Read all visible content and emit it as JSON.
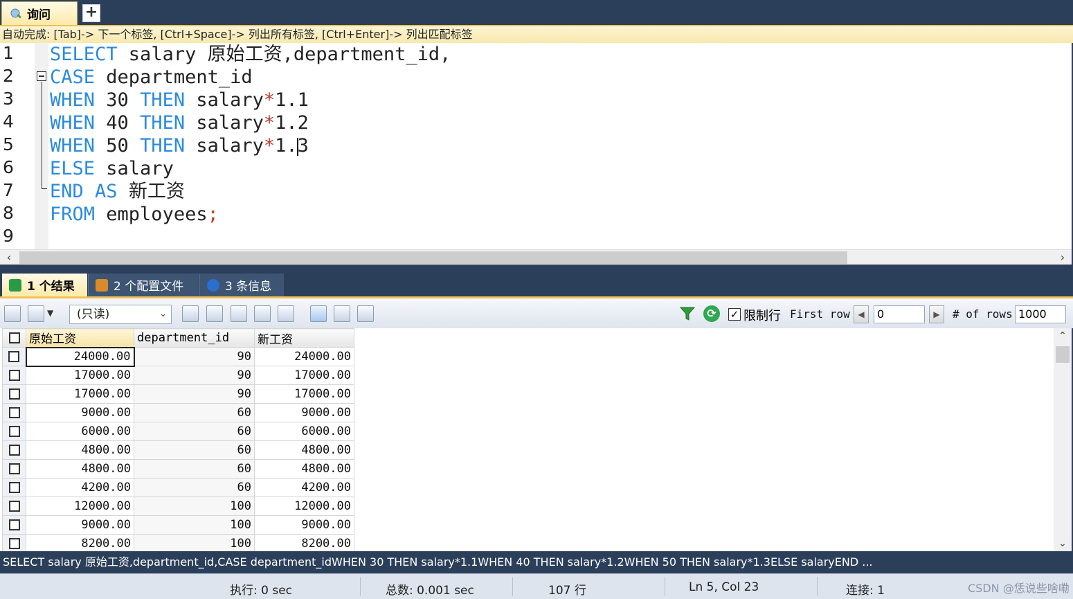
{
  "query_tab": {
    "label": "询问",
    "add_label": "+"
  },
  "autocomplete_hint": "自动完成: [Tab]-> 下一个标签, [Ctrl+Space]-> 列出所有标签, [Ctrl+Enter]-> 列出匹配标签",
  "editor": {
    "line_numbers": [
      "1",
      "2",
      "3",
      "4",
      "5",
      "6",
      "7",
      "8",
      "9"
    ],
    "lines": [
      [
        {
          "t": "SELECT",
          "c": "kw"
        },
        {
          "t": " salary 原始工资,department_id,"
        }
      ],
      [
        {
          "t": "CASE",
          "c": "kw"
        },
        {
          "t": " department_id"
        }
      ],
      [
        {
          "t": "WHEN",
          "c": "kw"
        },
        {
          "t": " 30 "
        },
        {
          "t": "THEN",
          "c": "kw"
        },
        {
          "t": " salary"
        },
        {
          "t": "*",
          "c": "op"
        },
        {
          "t": "1.1"
        }
      ],
      [
        {
          "t": "WHEN",
          "c": "kw"
        },
        {
          "t": " 40 "
        },
        {
          "t": "THEN",
          "c": "kw"
        },
        {
          "t": " salary"
        },
        {
          "t": "*",
          "c": "op"
        },
        {
          "t": "1.2"
        }
      ],
      [
        {
          "t": "WHEN",
          "c": "kw"
        },
        {
          "t": " 50 "
        },
        {
          "t": "THEN",
          "c": "kw"
        },
        {
          "t": " salary"
        },
        {
          "t": "*",
          "c": "op"
        },
        {
          "t": "1."
        },
        {
          "caret": true
        },
        {
          "t": "3"
        }
      ],
      [
        {
          "t": "ELSE",
          "c": "kw"
        },
        {
          "t": " salary"
        }
      ],
      [
        {
          "t": "END",
          "c": "kw"
        },
        {
          "t": " "
        },
        {
          "t": "AS",
          "c": "kw"
        },
        {
          "t": " 新工资"
        }
      ],
      [
        {
          "t": "FROM",
          "c": "kw"
        },
        {
          "t": " employees"
        },
        {
          "t": ";",
          "c": "op"
        }
      ],
      []
    ]
  },
  "result_tabs": [
    {
      "label": "1 个结果",
      "icon": "grid-result-icon",
      "color": "#2a9a44"
    },
    {
      "label": "2 个配置文件",
      "icon": "profile-icon",
      "color": "#d98a2b"
    },
    {
      "label": "3 条信息",
      "icon": "info-icon",
      "color": "#2a6fd0"
    }
  ],
  "toolbar": {
    "mode_select": "(只读)",
    "limit_checked": true,
    "limit_label": "限制行",
    "first_row_label": "First row",
    "first_row_value": "0",
    "rows_label": "# of rows",
    "rows_value": "1000"
  },
  "grid": {
    "columns": [
      "原始工资",
      "department_id",
      "新工资"
    ],
    "rows": [
      [
        "24000.00",
        "90",
        "24000.00"
      ],
      [
        "17000.00",
        "90",
        "17000.00"
      ],
      [
        "17000.00",
        "90",
        "17000.00"
      ],
      [
        "9000.00",
        "60",
        "9000.00"
      ],
      [
        "6000.00",
        "60",
        "6000.00"
      ],
      [
        "4800.00",
        "60",
        "4800.00"
      ],
      [
        "4800.00",
        "60",
        "4800.00"
      ],
      [
        "4200.00",
        "60",
        "4200.00"
      ],
      [
        "12000.00",
        "100",
        "12000.00"
      ],
      [
        "9000.00",
        "100",
        "9000.00"
      ],
      [
        "8200.00",
        "100",
        "8200.00"
      ]
    ]
  },
  "sql_preview": "SELECT salary 原始工资,department_id,CASE department_idWHEN 30 THEN salary*1.1WHEN 40 THEN salary*1.2WHEN 50 THEN salary*1.3ELSE salaryEND ...",
  "status": {
    "exec": "执行: 0 sec",
    "total": "总数: 0.001 sec",
    "rows": "107 行",
    "position": "Ln 5, Col 23",
    "connection": "连接: 1"
  },
  "watermark": "CSDN @恁说些啥嘞"
}
